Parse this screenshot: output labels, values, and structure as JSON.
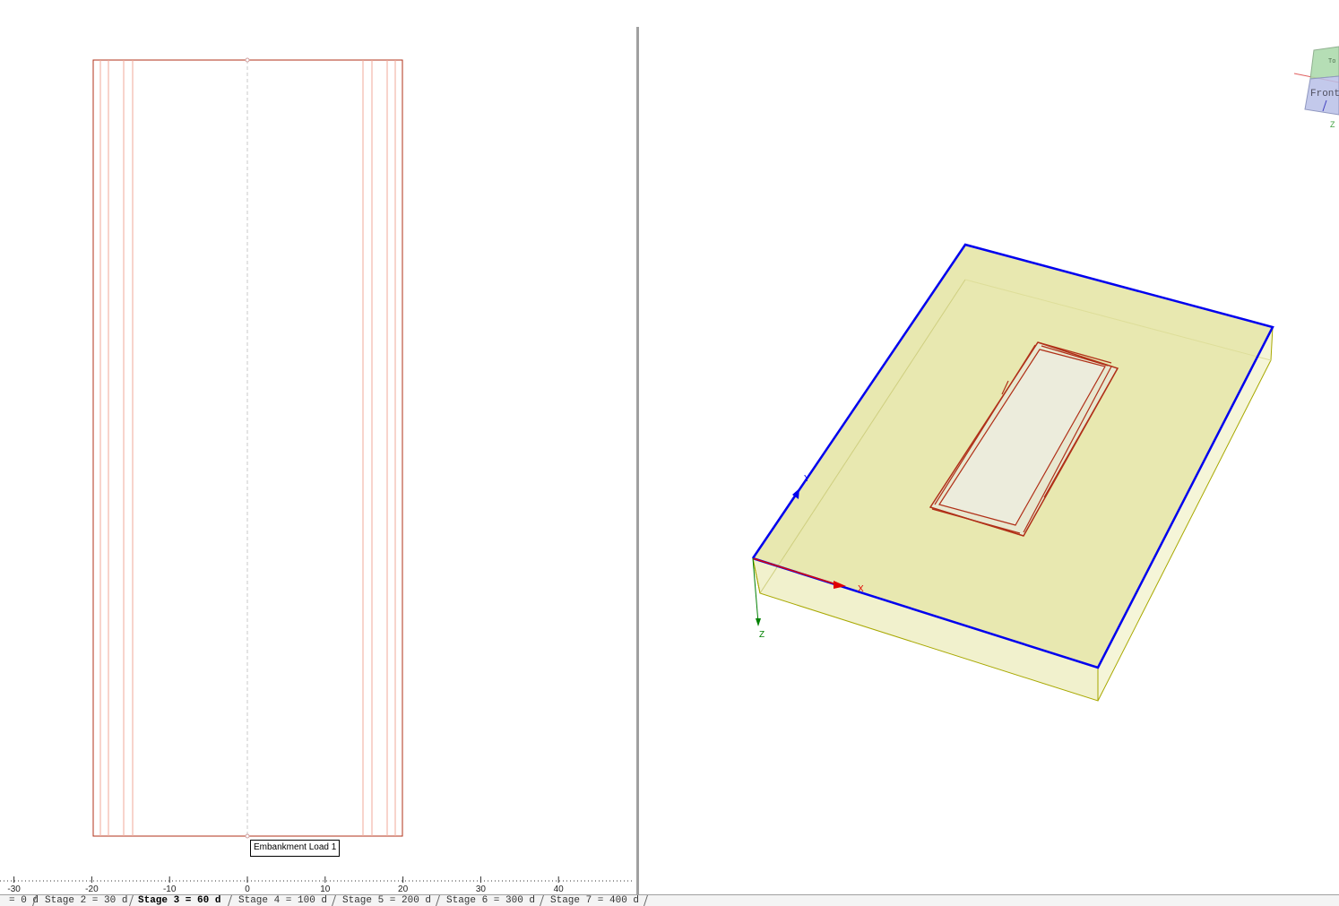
{
  "plan_view": {
    "load_label": "Embankment Load 1",
    "ruler_ticks": [
      "-30",
      "-20",
      "-10",
      "0",
      "10",
      "20",
      "30",
      "40"
    ]
  },
  "view3d": {
    "axes": {
      "x": "X",
      "y": "Y",
      "z": "Z"
    },
    "nav_cube": {
      "front_label": "Front",
      "top_label": "To",
      "z_label": "Z"
    }
  },
  "colors": {
    "model_edge": "#b03018",
    "soil_fill": "#e8e8b0",
    "selected_edge": "#0000ee",
    "axis_x": "#e00000",
    "axis_z": "#008000"
  },
  "tabs": [
    {
      "label": "= 0 d",
      "active": false
    },
    {
      "label": "Stage 2 = 30 d",
      "active": false
    },
    {
      "label": "Stage 3 = 60 d",
      "active": true
    },
    {
      "label": "Stage 4 = 100 d",
      "active": false
    },
    {
      "label": "Stage 5 = 200 d",
      "active": false
    },
    {
      "label": "Stage 6 = 300 d",
      "active": false
    },
    {
      "label": "Stage 7 = 400 d",
      "active": false
    }
  ]
}
